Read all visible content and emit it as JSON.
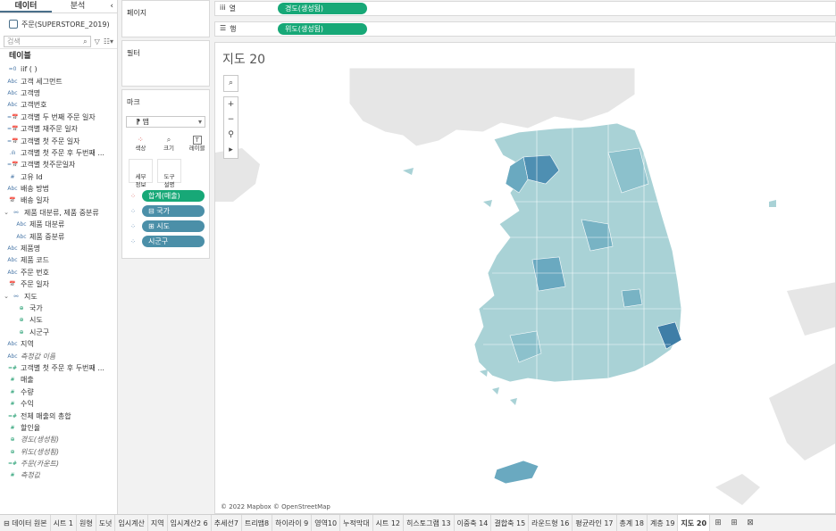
{
  "left_pane": {
    "tabs": [
      "데이터",
      "분석"
    ],
    "collapse_glyph": "‹",
    "datasource": "주문(SUPERSTORE_2019)",
    "search_placeholder": "검색",
    "section_title": "테이블",
    "fields": [
      {
        "icon": "=0",
        "label": "iif ( )",
        "type": "calc"
      },
      {
        "icon": "Abc",
        "label": "고객 세그먼트",
        "type": "dim"
      },
      {
        "icon": "Abc",
        "label": "고객명",
        "type": "dim"
      },
      {
        "icon": "Abc",
        "label": "고객번호",
        "type": "dim"
      },
      {
        "icon": "=📅",
        "label": "고객별 두 번째 주문 일자",
        "type": "calc"
      },
      {
        "icon": "=📅",
        "label": "고객별 재주문 일자",
        "type": "calc"
      },
      {
        "icon": "=📅",
        "label": "고객별 첫 주문 일자",
        "type": "calc"
      },
      {
        "icon": ".ılı",
        "label": "고객별 첫 주문 후 두번째 ...",
        "type": "calc"
      },
      {
        "icon": "=📅",
        "label": "고객별 첫주문일자",
        "type": "calc"
      },
      {
        "icon": "#",
        "label": "고유 Id",
        "type": "dim"
      },
      {
        "icon": "Abc",
        "label": "배송 방법",
        "type": "dim"
      },
      {
        "icon": "📅",
        "label": "배송 일자",
        "type": "dim"
      },
      {
        "icon": "⚯",
        "label": "제품 대분류, 제품 중분류",
        "type": "hier",
        "expand": "⌄"
      },
      {
        "icon": "Abc",
        "label": "제품 대분류",
        "type": "sub"
      },
      {
        "icon": "Abc",
        "label": "제품 중분류",
        "type": "sub"
      },
      {
        "icon": "Abc",
        "label": "제품명",
        "type": "dim"
      },
      {
        "icon": "Abc",
        "label": "제품 코드",
        "type": "dim"
      },
      {
        "icon": "Abc",
        "label": "주문 번호",
        "type": "dim"
      },
      {
        "icon": "📅",
        "label": "주문 일자",
        "type": "dim"
      },
      {
        "icon": "⚯",
        "label": "지도",
        "type": "hier",
        "expand": "⌄"
      },
      {
        "icon": "⊕",
        "label": "국가",
        "type": "sub"
      },
      {
        "icon": "⊕",
        "label": "시도",
        "type": "sub"
      },
      {
        "icon": "⊕",
        "label": "시군구",
        "type": "sub"
      },
      {
        "icon": "Abc",
        "label": "지역",
        "type": "dim"
      },
      {
        "icon": "Abc",
        "label": "측정값 이름",
        "type": "italic"
      },
      {
        "icon": "=#",
        "label": "고객별 첫 주문 후 두번째 ...",
        "type": "meas"
      },
      {
        "icon": "#",
        "label": "매출",
        "type": "meas"
      },
      {
        "icon": "#",
        "label": "수량",
        "type": "meas"
      },
      {
        "icon": "#",
        "label": "수익",
        "type": "meas"
      },
      {
        "icon": "=#",
        "label": "전체 매출의 총합",
        "type": "meas"
      },
      {
        "icon": "#",
        "label": "할인율",
        "type": "meas"
      },
      {
        "icon": "⊕",
        "label": "경도(생성됨)",
        "type": "meas-italic"
      },
      {
        "icon": "⊕",
        "label": "위도(생성됨)",
        "type": "meas-italic"
      },
      {
        "icon": "=#",
        "label": "주문(카운트)",
        "type": "meas-italic"
      },
      {
        "icon": "#",
        "label": "측정값",
        "type": "meas-italic"
      }
    ]
  },
  "pages_card": {
    "title": "페이지"
  },
  "filters_card": {
    "title": "필터"
  },
  "marks_card": {
    "title": "마크",
    "mark_type_icon": "⁋",
    "mark_type": "맵",
    "buttons": [
      {
        "glyph": "⁘",
        "label": "색상",
        "icon": "color-icon"
      },
      {
        "glyph": "⌕",
        "label": "크기",
        "icon": "size-icon"
      },
      {
        "glyph": "T",
        "label": "레이블",
        "icon": "label-icon"
      },
      {
        "glyph": "",
        "label": "세부\n정보",
        "icon": "detail-icon"
      },
      {
        "glyph": "",
        "label": "도구\n설명",
        "icon": "tooltip-icon"
      }
    ],
    "pills": [
      {
        "icon": "⁘",
        "label": "합계(매출)",
        "color": "green"
      },
      {
        "icon": "⁘",
        "label": "⊟ 국가",
        "color": "teal"
      },
      {
        "icon": "⁘",
        "label": "⊞ 시도",
        "color": "teal"
      },
      {
        "icon": "⁘",
        "label": "시군구",
        "color": "teal"
      }
    ]
  },
  "columns_shelf": {
    "icon": "iii",
    "label": "열",
    "pill": "경도(생성됨)"
  },
  "rows_shelf": {
    "icon": "☰",
    "label": "행",
    "pill": "위도(생성됨)"
  },
  "view": {
    "title": "지도 20",
    "attribution": "© 2022 Mapbox © OpenStreetMap",
    "map_tools": [
      "⌕",
      "+",
      "−",
      "⚲",
      "▸"
    ]
  },
  "colors": {
    "accent_green": "#17a877",
    "pill_teal": "#4b8fa8",
    "map_low": "#b7dde0",
    "map_high": "#2f6f98"
  },
  "bottom_tabs": [
    {
      "label": "⊟ 데이터 원본",
      "active": false
    },
    {
      "label": "시트 1",
      "active": false
    },
    {
      "label": "원형",
      "active": false
    },
    {
      "label": "도넛",
      "active": false
    },
    {
      "label": "임시계산",
      "active": false
    },
    {
      "label": "지역",
      "active": false
    },
    {
      "label": "임시계산2 6",
      "active": false
    },
    {
      "label": "추세선7",
      "active": false
    },
    {
      "label": "트리맵8",
      "active": false
    },
    {
      "label": "하이라이 9",
      "active": false
    },
    {
      "label": "영역10",
      "active": false
    },
    {
      "label": "누적막대",
      "active": false
    },
    {
      "label": "시트 12",
      "active": false
    },
    {
      "label": "히스토그램 13",
      "active": false
    },
    {
      "label": "이중축 14",
      "active": false
    },
    {
      "label": "결합축 15",
      "active": false
    },
    {
      "label": "라운드형 16",
      "active": false
    },
    {
      "label": "평균라인 17",
      "active": false
    },
    {
      "label": "총계 18",
      "active": false
    },
    {
      "label": "계층 19",
      "active": false
    },
    {
      "label": "지도 20",
      "active": true
    }
  ],
  "bottom_icons": [
    "new-sheet-icon",
    "new-dashboard-icon",
    "new-story-icon"
  ]
}
